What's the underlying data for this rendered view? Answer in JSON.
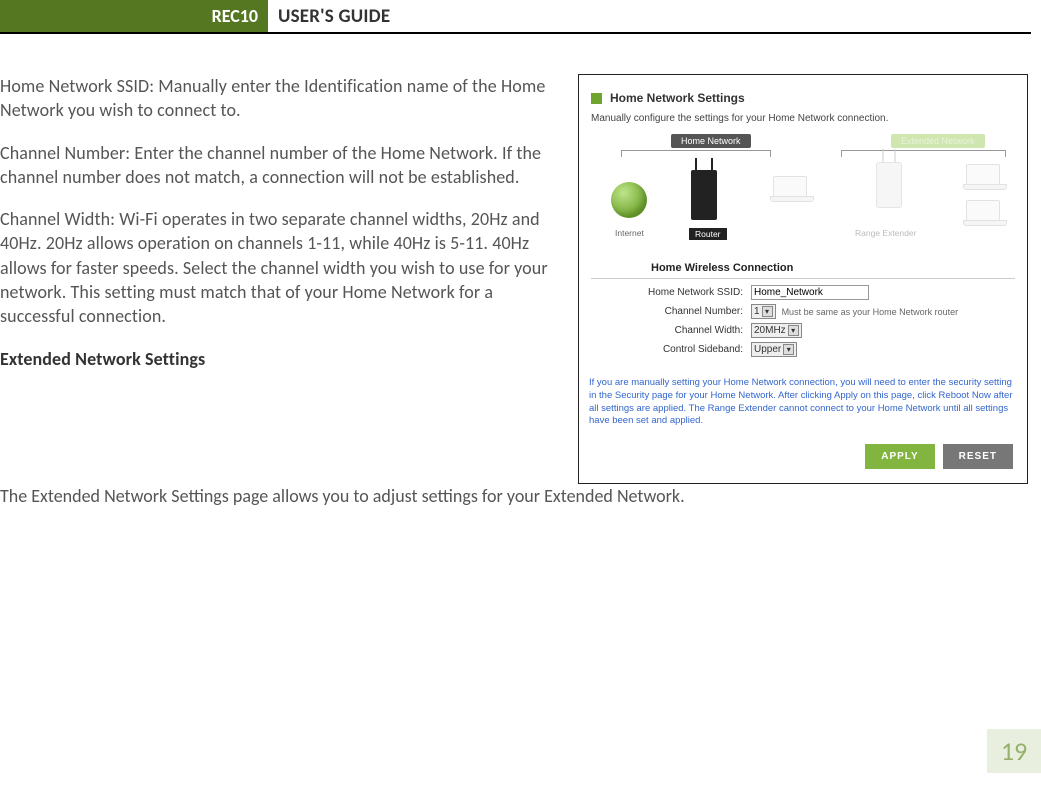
{
  "header": {
    "badge": "REC10",
    "title": "USER'S GUIDE"
  },
  "body": {
    "p1": "Home Network SSID: Manually enter the Identification name of the Home Network you wish to connect to.",
    "p2": "Channel Number: Enter the channel number of the Home Network.  If the channel number does not match, a connection will not be established.",
    "p3": "Channel Width: Wi-Fi operates in two separate channel widths, 20Hz and 40Hz.  20Hz allows operation on channels 1-11, while 40Hz is 5-11.  40Hz allows for faster speeds.  Select the channel width you wish to use for your network. This setting must match that of your Home Network for a successful connection.",
    "h1": "Extended Network Settings",
    "p4": "The Extended Network Settings page allows you to adjust settings for your Extended Network."
  },
  "panel": {
    "title": "Home Network Settings",
    "subtitle": "Manually configure the settings for your Home Network connection.",
    "diagram": {
      "home_label": "Home Network",
      "ext_label": "Extended Network",
      "internet": "Internet",
      "router": "Router",
      "range_extender": "Range Extender"
    },
    "form": {
      "section_title": "Home Wireless Connection",
      "ssid_label": "Home Network SSID:",
      "ssid_value": "Home_Network",
      "chnum_label": "Channel Number:",
      "chnum_value": "1",
      "chnum_note": "Must be same as your Home Network router",
      "chwidth_label": "Channel Width:",
      "chwidth_value": "20MHz",
      "sideband_label": "Control Sideband:",
      "sideband_value": "Upper"
    },
    "note": "If you are manually setting your Home Network connection, you will need to enter the security setting in the Security page for your Home Network. After clicking Apply on this page, click Reboot Now after all settings are applied. The Range Extender cannot connect to your Home Network until all settings have been set and applied.",
    "apply": "APPLY",
    "reset": "RESET"
  },
  "page_number": "19"
}
